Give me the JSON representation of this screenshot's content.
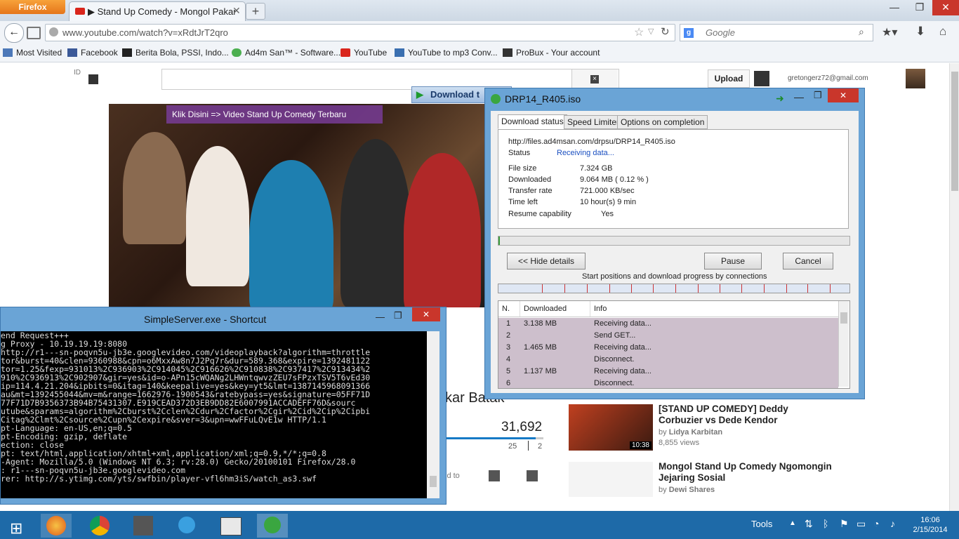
{
  "browser": {
    "menu_button": "Firefox",
    "tab_title": "▶ Stand Up Comedy - Mongol Pakar K...",
    "url": "www.youtube.com/watch?v=xRdtJrT2qro",
    "search_engine": "Google",
    "search_placeholder": "Google",
    "bookmarks": [
      {
        "label": "Most Visited",
        "icon": "bookmarks-icon"
      },
      {
        "label": "Facebook",
        "icon": "facebook-icon"
      },
      {
        "label": "Berita Bola, PSSI, Indo...",
        "icon": "site-icon"
      },
      {
        "label": "Ad4m San™ - Software...",
        "icon": "gear-icon"
      },
      {
        "label": "YouTube",
        "icon": "youtube-icon"
      },
      {
        "label": "YouTube to mp3 Conv...",
        "icon": "mp3-icon"
      },
      {
        "label": "ProBux - Your account",
        "icon": "probux-icon"
      }
    ]
  },
  "youtube": {
    "country": "ID",
    "upload_label": "Upload",
    "account_email": "gretongerz72@gmail.com",
    "video_banner": "Klik Disini => Video Stand Up Comedy Terbaru",
    "download_button": "Download t",
    "title_partial": "kar Batak",
    "views": "31,692",
    "likes": "25",
    "dislikes": "2",
    "add_to": "ld to",
    "suggestions": [
      {
        "title": "[STAND UP COMEDY] Deddy Corbuzier vs Dede Kendor",
        "by": "by",
        "channel": "Lidya Karbitan",
        "views": "8,855 views",
        "duration": "10:38"
      },
      {
        "title": "Mongol Stand Up Comedy Ngomongin Jejaring Sosial",
        "by": "by",
        "channel": "Dewi Shares",
        "views": "",
        "duration": ""
      }
    ]
  },
  "idm": {
    "title": "DRP14_R405.iso",
    "tabs": [
      "Download status",
      "Speed Limiter",
      "Options on completion"
    ],
    "url": "http://files.ad4msan.com/drpsu/DRP14_R405.iso",
    "status_label": "Status",
    "status_value": "Receiving data...",
    "fields": [
      {
        "label": "File size",
        "value": "7.324  GB"
      },
      {
        "label": "Downloaded",
        "value": "9.064  MB  ( 0.12 % )"
      },
      {
        "label": "Transfer rate",
        "value": "721.000  KB/sec"
      },
      {
        "label": "Time left",
        "value": "10 hour(s) 9 min"
      },
      {
        "label": "Resume capability",
        "value": "Yes"
      }
    ],
    "progress_fraction": 0.0012,
    "hide_details_button": "<< Hide details",
    "pause_button": "Pause",
    "cancel_button": "Cancel",
    "connections_caption": "Start positions and download progress by connections",
    "table_headers": [
      "N.",
      "Downloaded",
      "Info"
    ],
    "rows": [
      {
        "n": "1",
        "downloaded": "3.138  MB",
        "info": "Receiving data..."
      },
      {
        "n": "2",
        "downloaded": "",
        "info": "Send GET..."
      },
      {
        "n": "3",
        "downloaded": "1.465  MB",
        "info": "Receiving data..."
      },
      {
        "n": "4",
        "downloaded": "",
        "info": "Disconnect."
      },
      {
        "n": "5",
        "downloaded": "1.137  MB",
        "info": "Receiving data..."
      },
      {
        "n": "6",
        "downloaded": "",
        "info": "Disconnect."
      }
    ]
  },
  "cmd": {
    "title": "SimpleServer.exe - Shortcut",
    "lines": [
      "end Request+++",
      "g Proxy - 10.19.19.19:8080",
      "http://r1---sn-poqvn5u-jb3e.googlevideo.com/videoplayback?algorithm=throttle",
      "tor&burst=40&clen=9360988&cpn=o6MxxAw8n7J2Pq7r&dur=589.368&expire=1392481122",
      "tor=1.25&fexp=931013%2C936903%2C914045%2C916626%2C910838%2C937417%2C913434%2",
      "910%2C936913%2C902907&gir=yes&id=o-APn15cWQANg2LHWntqwvzZEU7sFPzxTSV5T6vEd30",
      "ip=114.4.21.204&ipbits=0&itag=140&keepalive=yes&key=yt5&lmt=1387145968091366",
      "au&mt=1392455044&mv=m&range=1662976-1900543&ratebypass=yes&signature=05FF71D",
      "77F71D7B9356373B94B75431307.E919CEAD372D3EB9DD82E6007991ACCADEFF76D&sourc",
      "utube&sparams=algorithm%2Cburst%2Cclen%2Cdur%2Cfactor%2Cgir%2Cid%2Cip%2Cipbi",
      "Citag%2Clmt%2Csource%2Cupn%2Cexpire&sver=3&upn=wwFFuLQvE1w HTTP/1.1",
      "pt-Language: en-US,en;q=0.5",
      "pt-Encoding: gzip, deflate",
      "ection: close",
      "pt: text/html,application/xhtml+xml,application/xml;q=0.9,*/*;q=0.8",
      "-Agent: Mozilla/5.0 (Windows NT 6.3; rv:28.0) Gecko/20100101 Firefox/28.0",
      ": r1---sn-poqvn5u-jb3e.googlevideo.com",
      "rer: http://s.ytimg.com/yts/swfbin/player-vfl6hm3iS/watch_as3.swf"
    ]
  },
  "taskbar": {
    "tools_label": "Tools",
    "time": "16:06",
    "date": "2/15/2014"
  }
}
